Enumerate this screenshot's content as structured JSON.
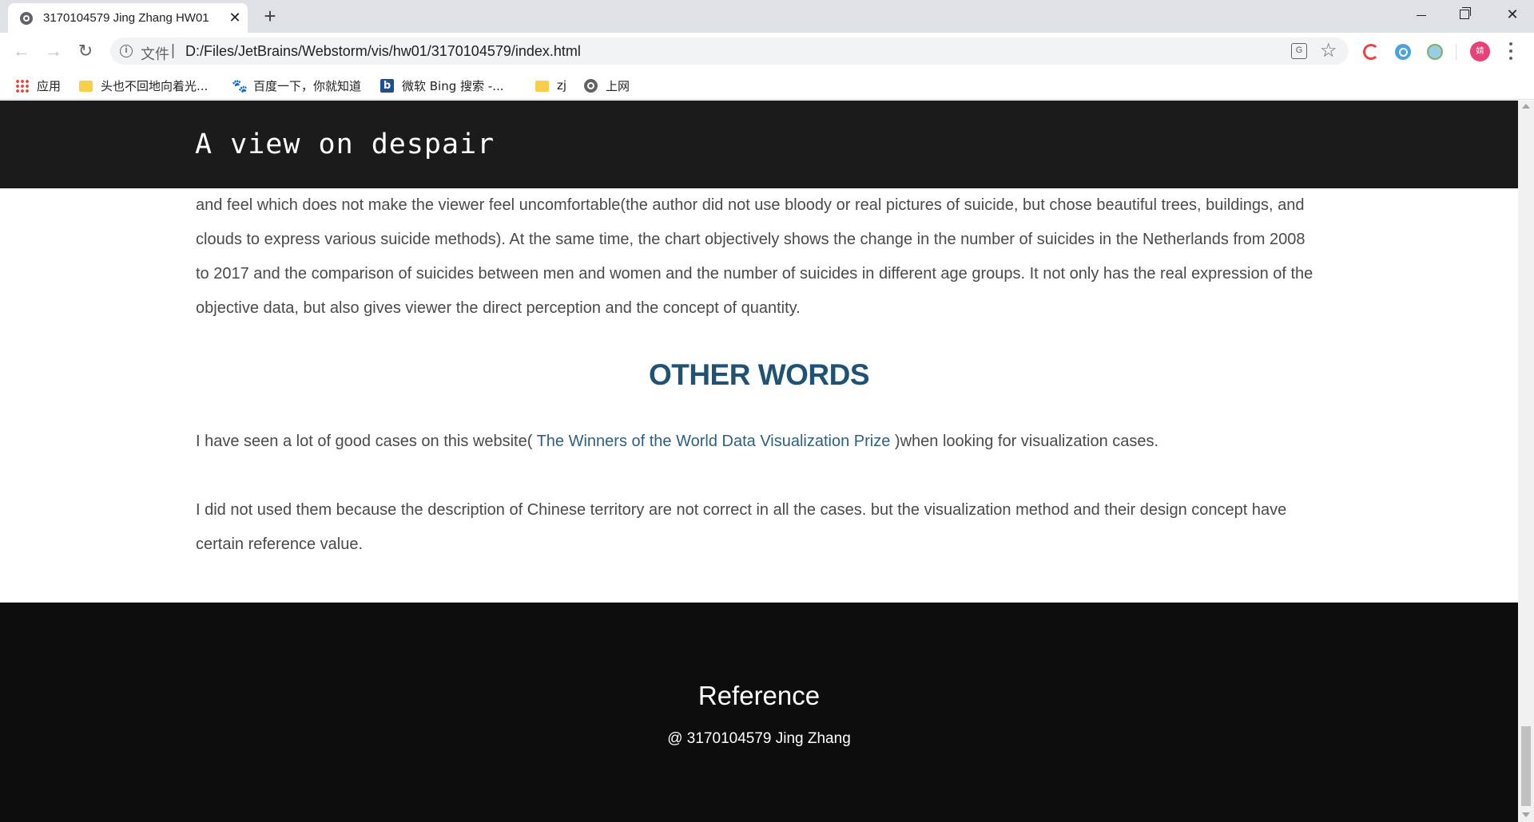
{
  "browser": {
    "tab_title": "3170104579 Jing Zhang HW01",
    "tab_close_glyph": "✕",
    "new_tab_glyph": "+",
    "address_scheme": "文件",
    "address_separator": "|",
    "address_url": "D:/Files/JetBrains/Webstorm/vis/hw01/3170104579/index.html",
    "translate_glyph": "G",
    "profile_initial": "婧",
    "bookmarks": [
      {
        "label": "应用",
        "icon": "apps-icon"
      },
      {
        "label": "头也不回地向着光...",
        "icon": "folder-icon"
      },
      {
        "label": "百度一下，你就知道",
        "icon": "baidu-paw-icon"
      },
      {
        "label": "微软 Bing 搜索 -...",
        "icon": "bing-icon"
      },
      {
        "label": "zj",
        "icon": "folder-icon"
      },
      {
        "label": "上网",
        "icon": "globe-icon"
      }
    ],
    "icons": {
      "back": "←",
      "forward": "→",
      "reload": "↻",
      "info": "i",
      "star": "☆",
      "paw": "🐾",
      "bing": "b"
    }
  },
  "page": {
    "site_title": "A view on despair",
    "para1": "and feel which does not make the viewer feel uncomfortable(the author did not use bloody or real pictures of suicide, but chose beautiful trees, buildings, and clouds to express various suicide methods). At the same time, the chart objectively shows the change in the number of suicides in the Netherlands from 2008 to 2017 and the comparison of suicides between men and women and the number of suicides in different age groups. It not only has the real expression of the objective data, but also gives viewer the direct perception and the concept of quantity.",
    "section_heading": "OTHER WORDS",
    "para2_before": "I have seen a lot of good cases on this website(",
    "para2_link": " The Winners of the World Data Visualization Prize ",
    "para2_after": ")when looking for visualization cases.",
    "para3": "I did not used them because the description of Chinese territory are not correct in all the cases. but the visualization method and their design concept have certain reference value.",
    "footer_title": "Reference",
    "footer_credit": "@ 3170104579 Jing Zhang"
  }
}
